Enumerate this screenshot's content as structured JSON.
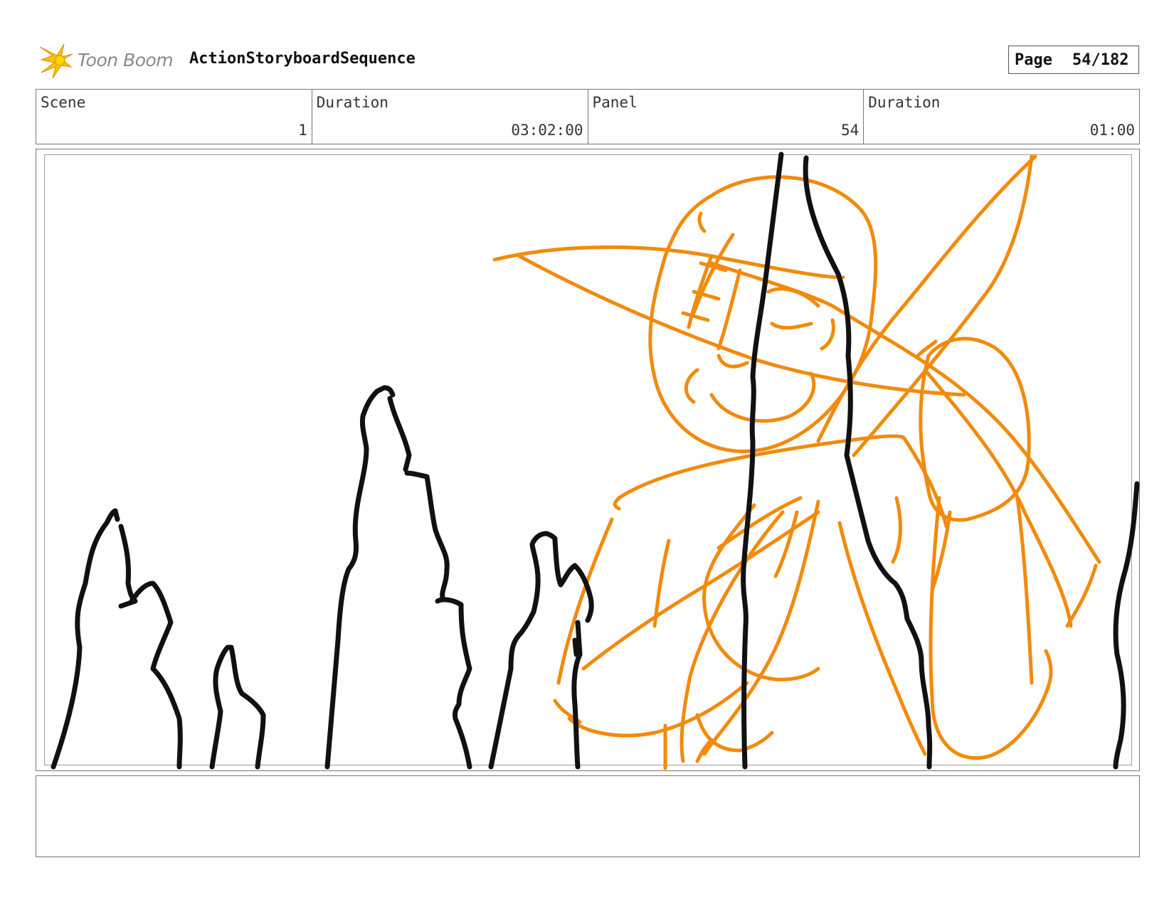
{
  "header": {
    "logo_text": "Toon Boom",
    "sequence_title": "ActionStoryboardSequence",
    "page_label": "Page",
    "page_value": "54/182"
  },
  "info": [
    {
      "label": "Scene",
      "value": "1"
    },
    {
      "label": "Duration",
      "value": "03:02:00"
    },
    {
      "label": "Panel",
      "value": "54"
    },
    {
      "label": "Duration",
      "value": "01:00"
    }
  ],
  "notes": "",
  "colors": {
    "sketch": "#f28a0c",
    "ink": "#111111",
    "logo_star": "#f7c400"
  },
  "icons": {
    "logo": "starburst-logo-icon"
  }
}
